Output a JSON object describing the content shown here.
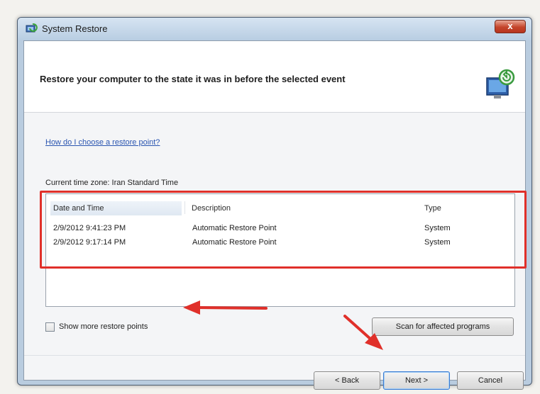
{
  "window": {
    "title": "System Restore",
    "close_glyph": "x"
  },
  "header": {
    "title": "Restore your computer to the state it was in before the selected event",
    "icon": "restore-computer-icon"
  },
  "help_link": "How do I choose a restore point?",
  "timezone": "Current time zone: Iran Standard Time",
  "table": {
    "columns": [
      "Date and Time",
      "Description",
      "Type"
    ],
    "rows": [
      [
        "2/9/2012 9:41:23 PM",
        "Automatic Restore Point",
        "System"
      ],
      [
        "2/9/2012 9:17:14 PM",
        "Automatic Restore Point",
        "System"
      ]
    ]
  },
  "checkbox": {
    "label": "Show more restore points",
    "checked": false
  },
  "buttons": {
    "scan": "Scan for affected programs",
    "back": "< Back",
    "next": "Next >",
    "cancel": "Cancel"
  },
  "annotation_color": "#e0302a"
}
